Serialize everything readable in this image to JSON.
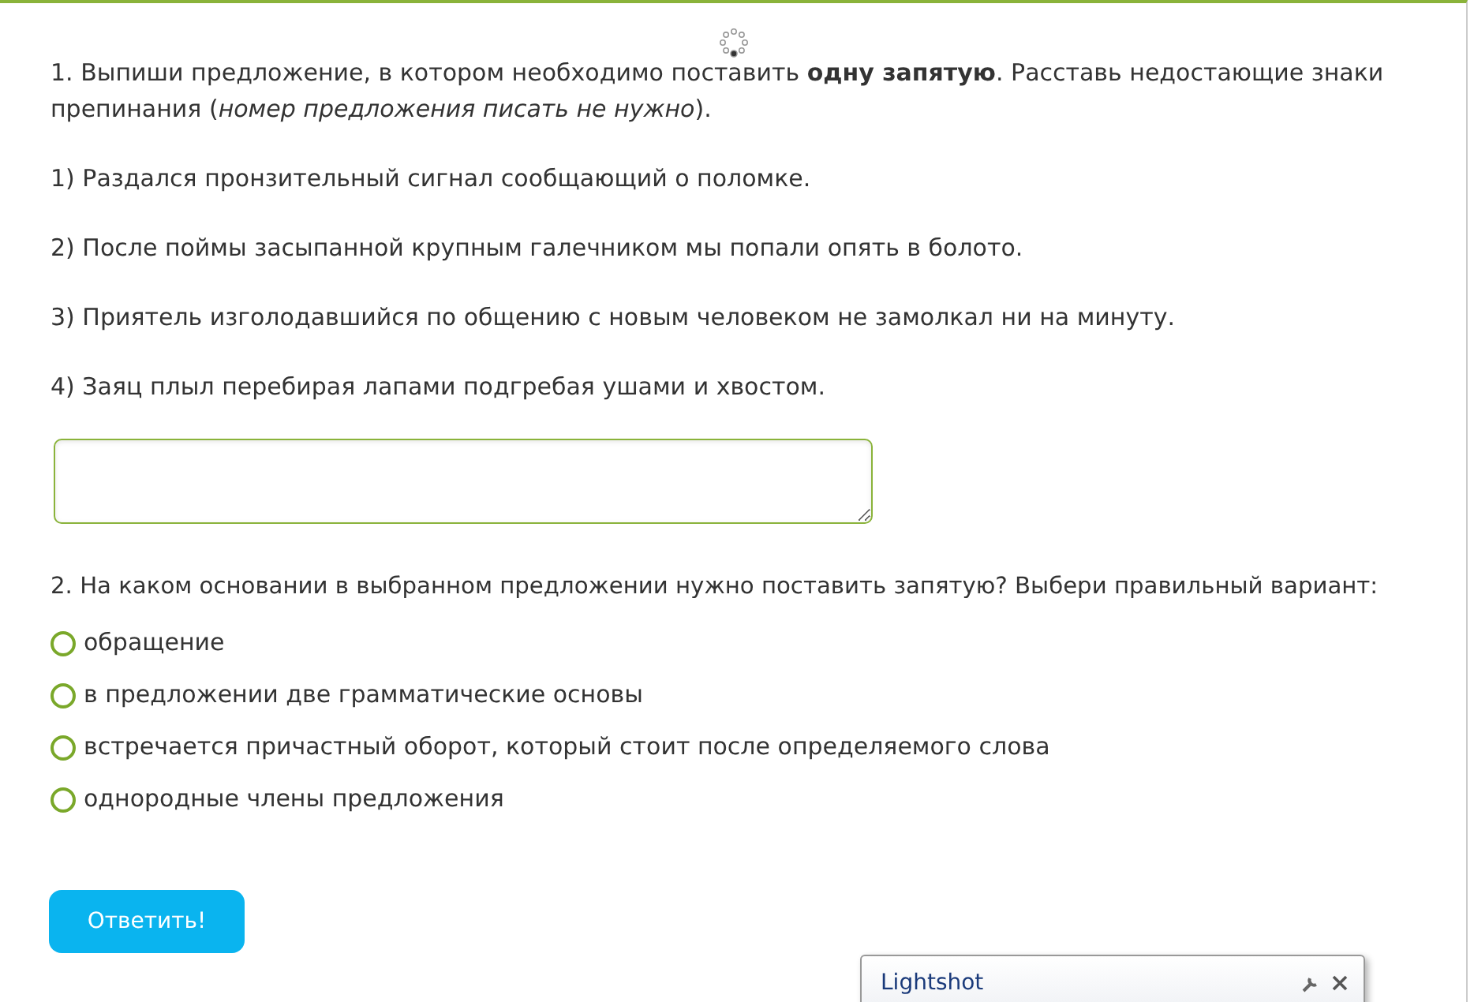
{
  "task1": {
    "prompt": "1. Выпиши предложение, в котором необходимо поставить **одну запятую**. Расставь недостающие знаки препинания (*номер предложения писать не нужно*).",
    "sentences": [
      "1) Раздался пронзительный сигнал сообщающий о поломке.",
      "2) После поймы засыпанной крупным галечником мы попали опять в болото.",
      "3) Приятель изголодавшийся по общению с новым человеком не замолкал ни на минуту.",
      "4) Заяц плыл перебирая лапами подгребая ушами и хвостом."
    ]
  },
  "task2": {
    "prompt": "2. На каком основании в выбранном предложении нужно поставить запятую? Выбери правильный вариант:",
    "options": [
      {
        "label": "обращение",
        "selected": false
      },
      {
        "label": "в предложении две грамматические основы",
        "selected": false
      },
      {
        "label": "встречается причастный оборот, который стоит после определяемого слова",
        "selected": false
      },
      {
        "label": "однородные члены предложения",
        "selected": false
      }
    ]
  },
  "submit": "Ответить!",
  "popup": {
    "title": "Lightshot"
  }
}
